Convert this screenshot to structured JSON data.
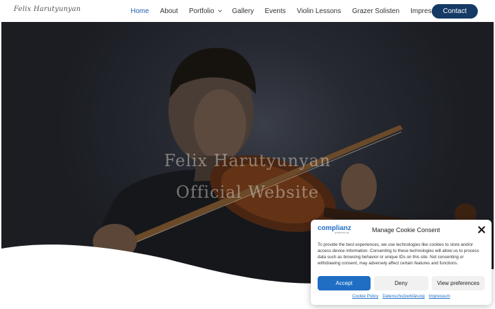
{
  "header": {
    "logo": "Felix Harutyunyan",
    "nav": [
      {
        "label": "Home",
        "active": true,
        "dropdown": false
      },
      {
        "label": "About",
        "active": false,
        "dropdown": false
      },
      {
        "label": "Portfolio",
        "active": false,
        "dropdown": true
      },
      {
        "label": "Gallery",
        "active": false,
        "dropdown": false
      },
      {
        "label": "Events",
        "active": false,
        "dropdown": false
      },
      {
        "label": "Violin Lessons",
        "active": false,
        "dropdown": false
      },
      {
        "label": "Grazer Solisten",
        "active": false,
        "dropdown": true
      },
      {
        "label": "Impressum",
        "active": false,
        "dropdown": true
      }
    ],
    "contact": "Contact"
  },
  "hero": {
    "title_line1": "Felix Harutyunyan",
    "title_line2": "Official Website"
  },
  "consent": {
    "brand": "complianz",
    "brand_sub": "powered by",
    "title": "Manage Cookie Consent",
    "text": "To provide the best experiences, we use technologies like cookies to store and/or access device information. Consenting to these technologies will allow us to process data such as browsing behavior or unique IDs on this site. Not consenting or withdrawing consent, may adversely affect certain features and functions.",
    "accept": "Accept",
    "deny": "Deny",
    "preferences": "View preferences",
    "links": [
      "Cookie Policy",
      "Datenschutzerklärung",
      "Impressum"
    ]
  },
  "colors": {
    "accent": "#1f5cb3",
    "contact_bg": "#153a66",
    "accept_bg": "#1f6ec4"
  }
}
